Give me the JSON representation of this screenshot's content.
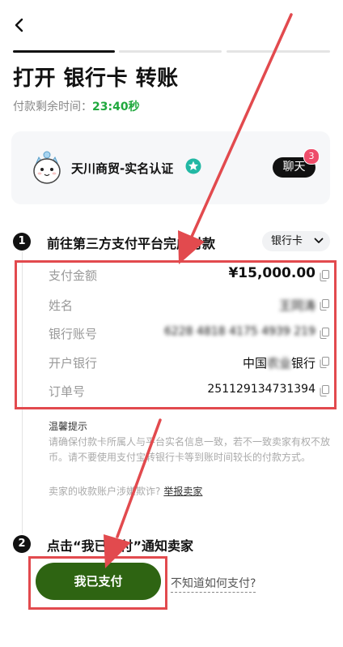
{
  "header": {
    "title": "打开 银行卡 转账",
    "timer_label": "付款剩余时间：",
    "timer_value": "23:40秒"
  },
  "seller": {
    "name": "天川商贸-实名认证",
    "chat_label": "聊天",
    "unread_count": "3"
  },
  "step1": {
    "number": "1",
    "title": "前往第三方支付平台完成付款",
    "method": "银行卡"
  },
  "details": [
    {
      "label": "支付金额",
      "value": "¥15,000.00"
    },
    {
      "label": "姓名",
      "value": "王同涛"
    },
    {
      "label": "银行账号",
      "value": "6228 4818 4175 4939 219"
    },
    {
      "label": "开户银行",
      "value_prefix": "中国",
      "value_hidden": "农业",
      "value_suffix": "银行"
    },
    {
      "label": "订单号",
      "value": "251129134731394"
    }
  ],
  "tips": {
    "title": "温馨提示",
    "body": "请确保付款卡所属人与平台实名信息一致，若不一致卖家有权不放币。请不要使用支付宝转银行卡等到账时间较长的付款方式。",
    "scam_text": "卖家的收款账户涉嫌欺诈?",
    "report_link": "举报卖家"
  },
  "step2": {
    "number": "2",
    "title": "点击“我已支付”通知卖家"
  },
  "actions": {
    "paid_button": "我已支付",
    "how_to_pay": "不知道如何支付?"
  },
  "colors": {
    "timer": "#1fa83d",
    "primary_button": "#2e6412",
    "annotation": "#e24a4e",
    "badge": "#ee4d6a"
  }
}
